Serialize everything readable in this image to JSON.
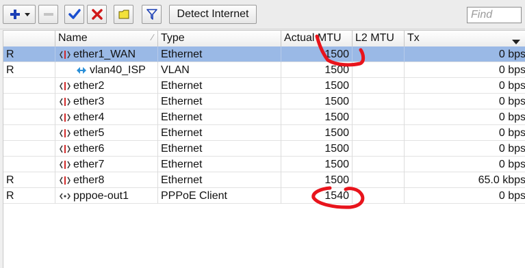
{
  "toolbar": {
    "add_icon": "plus-icon",
    "remove_icon": "minus-icon",
    "enable_icon": "check-icon",
    "disable_icon": "cross-icon",
    "comment_icon": "note-icon",
    "filter_icon": "funnel-icon",
    "detect_internet_label": "Detect Internet",
    "find_placeholder": "Find"
  },
  "table": {
    "columns": [
      "",
      "Name",
      "Type",
      "Actual MTU",
      "L2 MTU",
      "Tx"
    ],
    "rows": [
      {
        "flag": "R",
        "name": "ether1_WAN",
        "type": "Ethernet",
        "actual_mtu": "1500",
        "l2_mtu": "",
        "tx": "0 bps",
        "icon": "ethernet-icon",
        "selected": true
      },
      {
        "flag": "R",
        "name": "vlan40_ISP",
        "type": "VLAN",
        "actual_mtu": "1500",
        "l2_mtu": "",
        "tx": "0 bps",
        "icon": "vlan-icon",
        "selected": false
      },
      {
        "flag": "",
        "name": "ether2",
        "type": "Ethernet",
        "actual_mtu": "1500",
        "l2_mtu": "",
        "tx": "0 bps",
        "icon": "ethernet-icon",
        "selected": false
      },
      {
        "flag": "",
        "name": "ether3",
        "type": "Ethernet",
        "actual_mtu": "1500",
        "l2_mtu": "",
        "tx": "0 bps",
        "icon": "ethernet-icon",
        "selected": false
      },
      {
        "flag": "",
        "name": "ether4",
        "type": "Ethernet",
        "actual_mtu": "1500",
        "l2_mtu": "",
        "tx": "0 bps",
        "icon": "ethernet-icon",
        "selected": false
      },
      {
        "flag": "",
        "name": "ether5",
        "type": "Ethernet",
        "actual_mtu": "1500",
        "l2_mtu": "",
        "tx": "0 bps",
        "icon": "ethernet-icon",
        "selected": false
      },
      {
        "flag": "",
        "name": "ether6",
        "type": "Ethernet",
        "actual_mtu": "1500",
        "l2_mtu": "",
        "tx": "0 bps",
        "icon": "ethernet-icon",
        "selected": false
      },
      {
        "flag": "",
        "name": "ether7",
        "type": "Ethernet",
        "actual_mtu": "1500",
        "l2_mtu": "",
        "tx": "0 bps",
        "icon": "ethernet-icon",
        "selected": false
      },
      {
        "flag": "R",
        "name": "ether8",
        "type": "Ethernet",
        "actual_mtu": "1500",
        "l2_mtu": "",
        "tx": "65.0 kbps",
        "icon": "ethernet-icon",
        "selected": false
      },
      {
        "flag": "R",
        "name": "pppoe-out1",
        "type": "PPPoE Client",
        "actual_mtu": "1540",
        "l2_mtu": "",
        "tx": "0 bps",
        "icon": "pppoe-icon",
        "selected": false
      }
    ]
  },
  "colors": {
    "selection": "#9ab9e6",
    "annotation_red": "#e8141c",
    "add_blue": "#1b3fb5",
    "check_blue": "#1a4fd0",
    "cross_red": "#d01818",
    "note_yellow": "#f3e23a"
  }
}
